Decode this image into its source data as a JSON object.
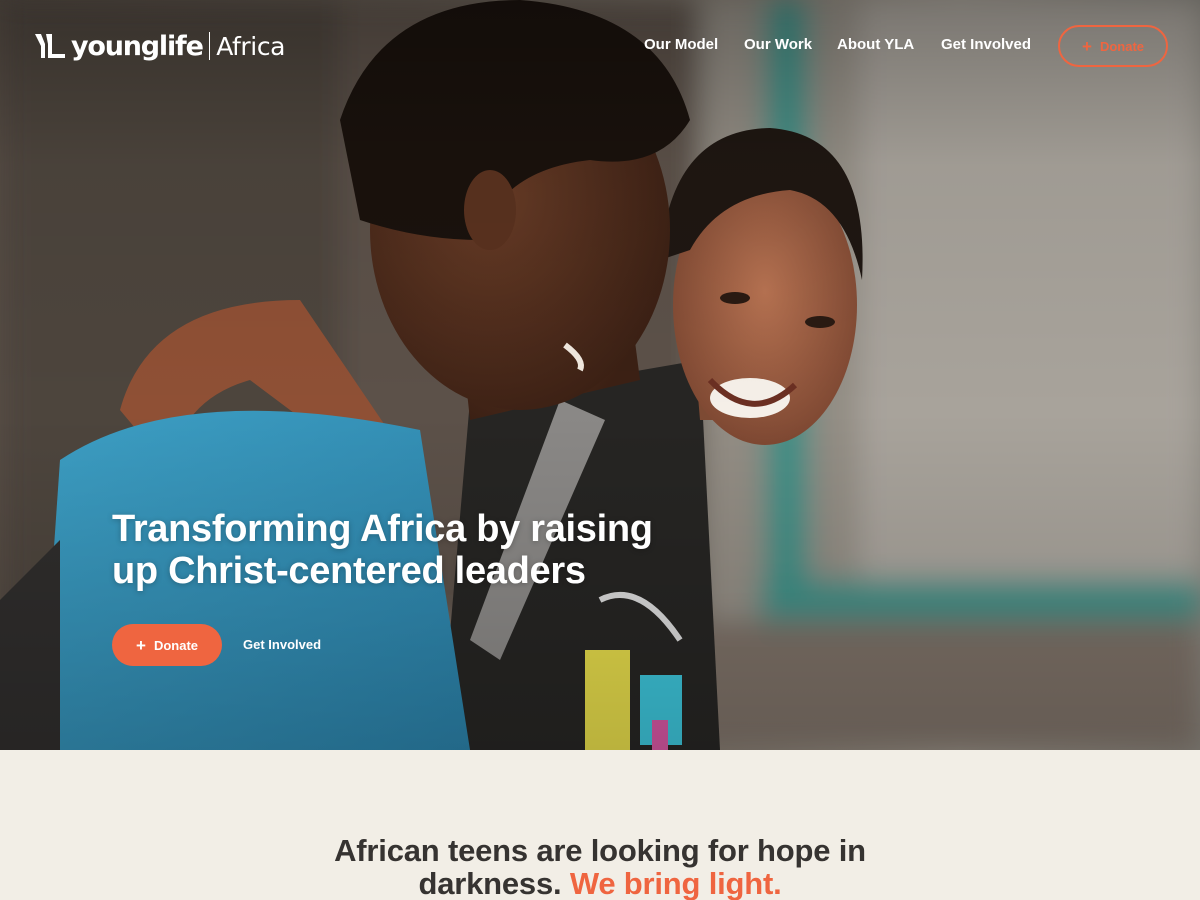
{
  "brand": {
    "logo_mark_icon": "young-life-logo-mark",
    "wordmark": "younglife",
    "region": "Africa",
    "colors": {
      "accent": "#ef6540",
      "text_dark": "#363331",
      "background_light": "#f2eee6",
      "white": "#ffffff"
    }
  },
  "nav": {
    "items": [
      {
        "label": "Our Model"
      },
      {
        "label": "Our Work"
      },
      {
        "label": "About YLA"
      },
      {
        "label": "Get Involved"
      }
    ],
    "donate": {
      "icon": "plus-icon",
      "label": "Donate"
    }
  },
  "hero": {
    "image": "photo-two-teens-laughing-walking",
    "title_line1": "Transforming Africa by raising",
    "title_line2": "up Christ-centered leaders",
    "donate": {
      "icon": "plus-icon",
      "label": "Donate"
    },
    "get_involved": "Get Involved"
  },
  "intro": {
    "heading_line1": "African teens are looking for hope in",
    "heading_line2_dark": "darkness.",
    "heading_line2_accent": "We bring light."
  }
}
